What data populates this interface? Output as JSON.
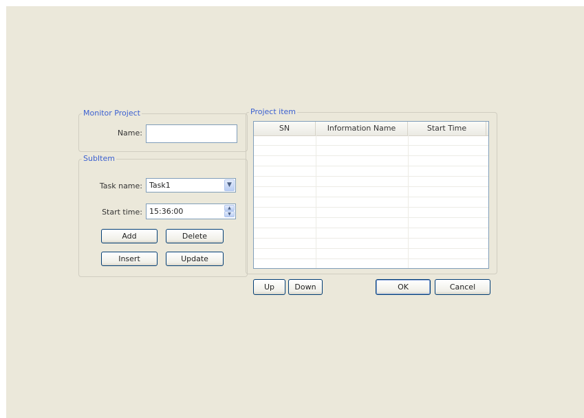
{
  "monitor_project": {
    "legend": "Monitor Project",
    "name_label": "Name:",
    "name_value": ""
  },
  "subitem": {
    "legend": "SubItem",
    "task_label": "Task name:",
    "task_value": "Task1",
    "start_label": "Start time:",
    "start_value": "15:36:00",
    "buttons": {
      "add": "Add",
      "delete": "Delete",
      "insert": "Insert",
      "update": "Update"
    }
  },
  "project_item": {
    "legend": "Project item",
    "columns": [
      "SN",
      "Information Name",
      "Start Time"
    ],
    "rows": []
  },
  "footer": {
    "up": "Up",
    "down": "Down",
    "ok": "OK",
    "cancel": "Cancel"
  },
  "icons": {
    "dropdown": "chevron-down-icon",
    "spinner": "spinner-updown-icon"
  },
  "colors": {
    "background": "#ebe8da",
    "legend_text": "#3a5fd0",
    "button_border": "#003c74"
  }
}
